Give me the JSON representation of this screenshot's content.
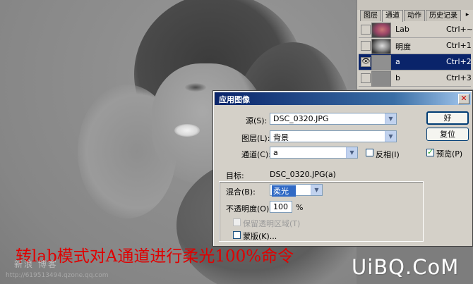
{
  "panel": {
    "tabs": [
      "图层",
      "通道",
      "动作",
      "历史记录"
    ],
    "active_tab": 1,
    "channels": [
      {
        "name": "Lab",
        "shortcut": "Ctrl+~",
        "visible": false,
        "selected": false,
        "thumb": "lab"
      },
      {
        "name": "明度",
        "shortcut": "Ctrl+1",
        "visible": false,
        "selected": false,
        "thumb": "ming"
      },
      {
        "name": "a",
        "shortcut": "Ctrl+2",
        "visible": true,
        "selected": true,
        "thumb": "ga"
      },
      {
        "name": "b",
        "shortcut": "Ctrl+3",
        "visible": false,
        "selected": false,
        "thumb": "gb"
      }
    ],
    "eye_glyph": "👁",
    "menu_glyph": "▸"
  },
  "dialog": {
    "title": "应用图像",
    "close_glyph": "✕",
    "source_label": "源(S):",
    "source_value": "DSC_0320.JPG",
    "layer_label": "图层(L):",
    "layer_value": "背景",
    "channel_label": "通道(C):",
    "channel_value": "a",
    "invert_label": "反相(I)",
    "invert_checked": false,
    "target_label": "目标:",
    "target_value": "DSC_0320.JPG(a)",
    "blend_label": "混合(B):",
    "blend_value": "柔光",
    "opacity_label": "不透明度(O):",
    "opacity_value": "100",
    "opacity_unit": "%",
    "preserve_label": "保留透明区域(T)",
    "mask_label": "蒙版(K)...",
    "ok_label": "好",
    "reset_label": "复位",
    "preview_label": "预览(P)",
    "preview_checked": true,
    "dropdown_glyph": "▼"
  },
  "caption": "转lab模式对A通道进行柔光100%命令",
  "watermark": {
    "left_text": "新浪 博客",
    "url": "http://619513494.qzone.qq.com",
    "logo": "UiBQ.CoM"
  },
  "colors": {
    "caption": "#e00000",
    "selection": "#0a246a"
  }
}
